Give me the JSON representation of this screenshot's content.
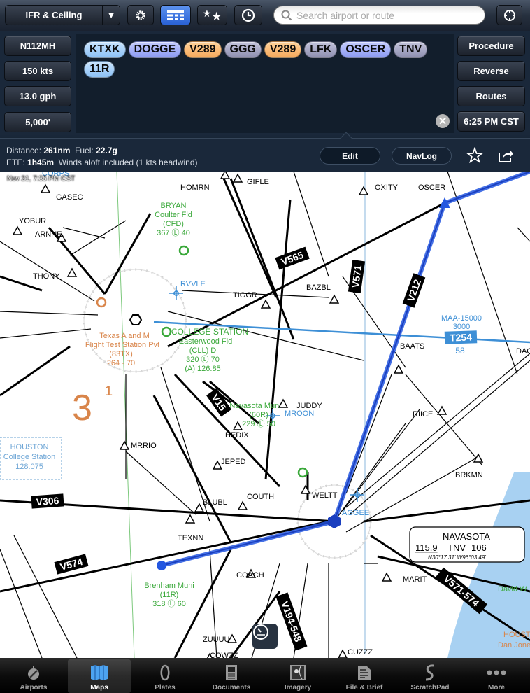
{
  "toolbar": {
    "layer_label": "IFR & Ceiling",
    "search_placeholder": "Search airport or route",
    "search_value": "",
    "active_tool": "map-settings"
  },
  "route": {
    "aircraft": "N112MH",
    "speed": "150 kts",
    "fuel_burn": "13.0 gph",
    "altitude": "5,000'",
    "waypoints": [
      {
        "label": "KTXK",
        "type": "airport"
      },
      {
        "label": "DOGGE",
        "type": "fix"
      },
      {
        "label": "V289",
        "type": "airway"
      },
      {
        "label": "GGG",
        "type": "navaid"
      },
      {
        "label": "V289",
        "type": "airway"
      },
      {
        "label": "LFK",
        "type": "navaid"
      },
      {
        "label": "OSCER",
        "type": "fix"
      },
      {
        "label": "TNV",
        "type": "navaid"
      },
      {
        "label": "11R",
        "type": "airport"
      }
    ],
    "buttons": {
      "procedure": "Procedure",
      "reverse": "Reverse",
      "routes": "Routes",
      "departure_time": "6:25 PM CST"
    }
  },
  "summary": {
    "distance_label": "Distance:",
    "distance_value": "261nm",
    "fuel_label": "Fuel:",
    "fuel_value": "22.7g",
    "ete_label": "ETE:",
    "ete_value": "1h45m",
    "winds_note": "Winds aloft included (1 kts headwind)",
    "edit_label": "Edit",
    "navlog_label": "NavLog"
  },
  "map": {
    "timestamp": "Nov 21, 7:35 PM CST",
    "colors": {
      "route": "#2457e0",
      "airway_blue": "#3d8fd6",
      "airport_green": "#3aa83a",
      "orange": "#d9854a",
      "water": "#a8d1f2"
    },
    "fixes": [
      {
        "name": "HOMRN"
      },
      {
        "name": "GIFLE"
      },
      {
        "name": "OXITY"
      },
      {
        "name": "OSCER"
      },
      {
        "name": "GASEC"
      },
      {
        "name": "YOBUR"
      },
      {
        "name": "ARNNE"
      },
      {
        "name": "THONY"
      },
      {
        "name": "TIGGR"
      },
      {
        "name": "BAZBL"
      },
      {
        "name": "BAATS"
      },
      {
        "name": "JUDDY"
      },
      {
        "name": "RIICE"
      },
      {
        "name": "BRKMN"
      },
      {
        "name": "MRRIO"
      },
      {
        "name": "HEDIX"
      },
      {
        "name": "JEPED"
      },
      {
        "name": "BLUBL"
      },
      {
        "name": "COUTH"
      },
      {
        "name": "WELTT"
      },
      {
        "name": "TEXNN"
      },
      {
        "name": "COACH"
      },
      {
        "name": "MARIT"
      },
      {
        "name": "ZUUUU"
      },
      {
        "name": "CUZZZ"
      },
      {
        "name": "COWZZ"
      }
    ],
    "rnav_fixes": [
      "RVVLE",
      "MROON",
      "AGGEE"
    ],
    "airports": [
      {
        "name": "BRYAN",
        "sub": "Coulter Fld",
        "id": "(CFD)",
        "info": "367 Ⓛ 40"
      },
      {
        "name": "COLLEGE STATION",
        "sub": "Easterwood Fld",
        "id": "(CLL) D",
        "info": "320 Ⓛ 70",
        "freq": "(A) 126.85"
      },
      {
        "name": "Navasota Muni",
        "id": "(60R)",
        "info": "229 Ⓛ 50"
      },
      {
        "name": "Brenham Muni",
        "id": "(11R)",
        "info": "318 Ⓛ 60"
      },
      {
        "name": "Texas A and M",
        "sub": "Flight Test Station Pvt",
        "id": "(83TX)",
        "info": "264 - 70"
      }
    ],
    "airways": [
      "V565",
      "V571",
      "V212",
      "T254",
      "V15",
      "V306",
      "V574",
      "V194-548",
      "V571-574"
    ],
    "t254_maa": "MAA-15000",
    "t254_mea": "3000",
    "t254_dist": "58",
    "navaid_box": {
      "name": "NAVASOTA",
      "freq": "115.9",
      "id": "TNV",
      "channel": "106",
      "coords": "N30°17.31' W96°03.49'"
    },
    "fss_box": {
      "name": "HOUSTON",
      "sub": "College Station",
      "freq": "128.075"
    },
    "mora": "3",
    "mora_sup": "1",
    "labels_misc": [
      "DAC",
      "HOUSTO",
      "Dan Jone",
      "David W",
      "CORPS"
    ]
  },
  "tabs": [
    {
      "label": "Airports",
      "icon": "airport-icon",
      "active": false
    },
    {
      "label": "Maps",
      "icon": "map-icon",
      "active": true
    },
    {
      "label": "Plates",
      "icon": "plates-icon",
      "active": false
    },
    {
      "label": "Documents",
      "icon": "documents-icon",
      "active": false
    },
    {
      "label": "Imagery",
      "icon": "imagery-icon",
      "active": false
    },
    {
      "label": "File & Brief",
      "icon": "file-brief-icon",
      "active": false
    },
    {
      "label": "ScratchPad",
      "icon": "scratchpad-icon",
      "active": false
    },
    {
      "label": "More",
      "icon": "more-icon",
      "active": false
    }
  ]
}
